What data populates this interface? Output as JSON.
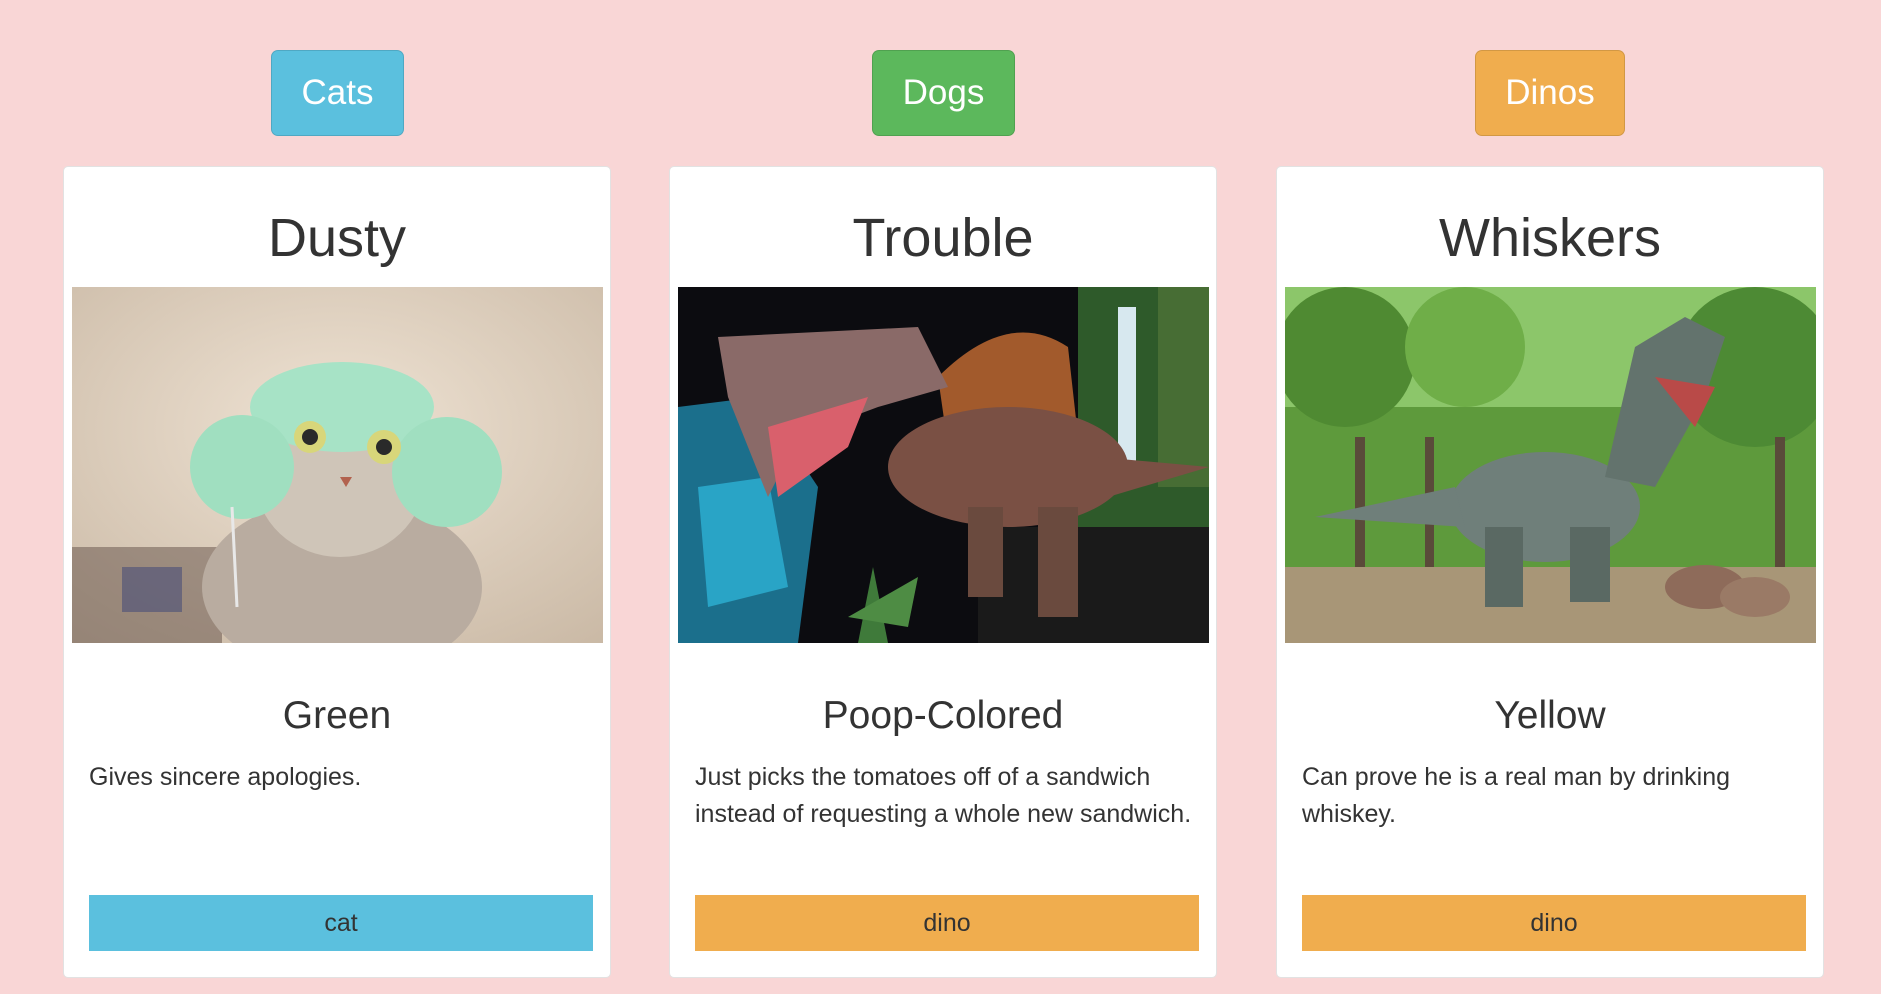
{
  "colors": {
    "page_background": "#f9d6d6",
    "cats": "#5bc0de",
    "dogs": "#5cb85c",
    "dinos": "#f0ad4e"
  },
  "filters": [
    {
      "label": "Cats",
      "color": "#5bc0de"
    },
    {
      "label": "Dogs",
      "color": "#5cb85c"
    },
    {
      "label": "Dinos",
      "color": "#f0ad4e"
    }
  ],
  "cards": [
    {
      "name": "Dusty",
      "image": "cat-with-knitted-hat",
      "color": "Green",
      "description": "Gives sincere apologies.",
      "tag": "cat",
      "tag_color": "#5bc0de"
    },
    {
      "name": "Trouble",
      "image": "spinosaurus-model",
      "color": "Poop-Colored",
      "description": "Just picks the tomatoes off of a sandwich instead of requesting a whole new sandwich.",
      "tag": "dino",
      "tag_color": "#f0ad4e"
    },
    {
      "name": "Whiskers",
      "image": "t-rex-in-forest",
      "color": "Yellow",
      "description": "Can prove he is a real man by drinking whiskey.",
      "tag": "dino",
      "tag_color": "#f0ad4e"
    }
  ]
}
